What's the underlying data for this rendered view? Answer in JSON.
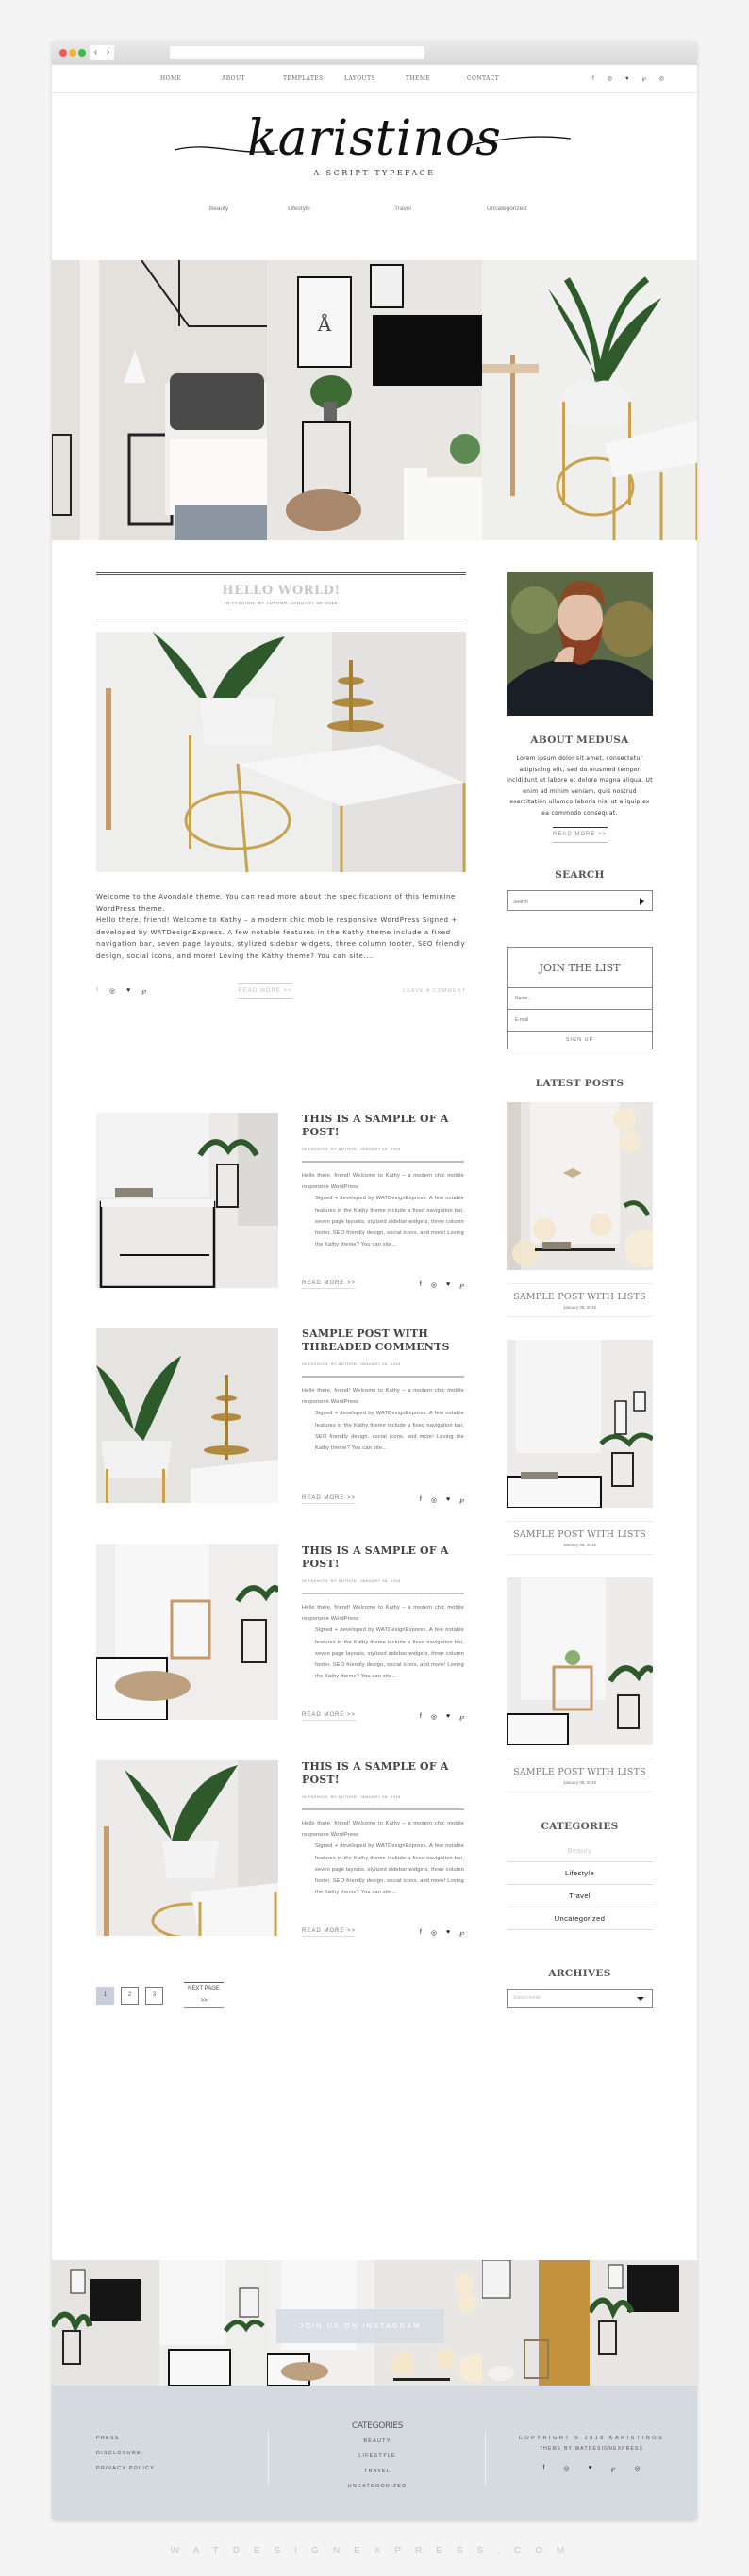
{
  "browser": {
    "back_icon": "‹",
    "forward_icon": "›"
  },
  "topnav": {
    "links": [
      "HOME",
      "ABOUT",
      "TEMPLATES",
      "LAYOUTS",
      "THEME",
      "CONTACT"
    ],
    "social_icons": [
      "facebook-icon",
      "instagram-icon",
      "twitter-icon",
      "pinterest-icon",
      "instagram-icon"
    ],
    "social_glyphs": [
      "f",
      "◎",
      "♥",
      "℘",
      "◎"
    ]
  },
  "header": {
    "logo_text": "karistinos",
    "tagline": "A SCRIPT TYPEFACE",
    "categories": [
      "Beauty",
      "Lifestyle",
      "Travel",
      "Uncategorized"
    ]
  },
  "featured_post": {
    "title": "HELLO WORLD!",
    "meta": "IN FASHION, BY AUTHOR, JANUARY 08, 2018",
    "paragraphs": [
      "Welcome to the Avondale theme. You can read more about the specifications of this feminine WordPress theme.",
      "Hello there, friend! Welcome to Kathy – a modern chic mobile responsive WordPress Signed + developed by WATDesignExpress. A few notable features in the Kathy theme include a fixed navigation bar, seven page layouts, stylized sidebar widgets, three column footer, SEO friendly design, social icons, and more! Loving the Kathy theme? You can site...."
    ],
    "read_more": "READ MORE >>",
    "leave_comment": "LEAVE A COMMENT",
    "share_glyphs": [
      "f",
      "◎",
      "♥",
      "℘"
    ]
  },
  "posts": [
    {
      "title": "THIS IS A SAMPLE OF A POST!",
      "meta": "IN FASHION, BY AUTHOR, JANUARY 08, 2018",
      "line1": "Hello there, friend! Welcome to Kathy – a modern chic mobile responsive WordPress",
      "line2": "Signed + developed by WATDesignExpress. A few notable features in the Kathy theme include a fixed navigation bar, seven page layouts, stylized sidebar widgets, three column footer, SEO friendly design, social icons, and more! Loving the Kathy theme? You can site...",
      "read_more": "READ MORE >>"
    },
    {
      "title": "SAMPLE POST WITH THREADED COMMENTS",
      "meta": "IN FASHION, BY AUTHOR, JANUARY 08, 2018",
      "line1": "Hello there, friend! Welcome to Kathy – a modern chic mobile responsive WordPress",
      "line2": "Signed + developed by WATDesignExpress. A few notable features in the Kathy theme include a fixed navigation bar, SEO friendly design, social icons, and more! Loving the Kathy theme? You can site...",
      "read_more": "READ MORE >>"
    },
    {
      "title": "THIS IS A SAMPLE OF A POST!",
      "meta": "IN FASHION, BY AUTHOR, JANUARY 08, 2018",
      "line1": "Hello there, friend! Welcome to Kathy – a modern chic mobile responsive WordPress",
      "line2": "Signed + developed by WATDesignExpress. A few notable features in the Kathy theme include a fixed navigation bar, seven page layouts, stylized sidebar widgets, three column footer, SEO friendly design, social icons, and more! Loving the Kathy theme? You can site...",
      "read_more": "READ MORE >>"
    },
    {
      "title": "THIS IS A SAMPLE OF A POST!",
      "meta": "IN FASHION, BY AUTHOR, JANUARY 08, 2018",
      "line1": "Hello there, friend! Welcome to Kathy – a modern chic mobile responsive WordPress",
      "line2": "Signed + developed by WATDesignExpress. A few notable features in the Kathy theme include a fixed navigation bar, seven page layouts, stylized sidebar widgets, three column footer, SEO friendly design, social icons, and more! Loving the Kathy theme? You can site...",
      "read_more": "READ MORE >>"
    }
  ],
  "pagination": {
    "pages": [
      "1",
      "2",
      "3"
    ],
    "current": "1",
    "next": "NEXT PAGE >>"
  },
  "sidebar": {
    "about": {
      "title": "ABOUT MEDUSA",
      "text": "Lorem ipsum dolor sit amet, consectetur adipiscing elit, sed do eiusmod tempor incididunt ut labore et dolore magna aliqua. Ut enim ad minim veniam, quis nostrud exercitation ullamco laboris nisi ut aliquip ex ea commodo consequat.",
      "read_more": "READ MORE >>"
    },
    "search": {
      "title": "SEARCH",
      "placeholder": "Search"
    },
    "newsletter": {
      "title": "JOIN THE LIST",
      "name_placeholder": "Name...",
      "email_placeholder": "E-mail",
      "button": "SIGN UP"
    },
    "latest": {
      "title": "LATEST POSTS",
      "items": [
        {
          "title": "SAMPLE POST WITH LISTS",
          "date": "January 08, 2018"
        },
        {
          "title": "SAMPLE POST WITH LISTS",
          "date": "January 08, 2018"
        },
        {
          "title": "SAMPLE POST WITH LISTS",
          "date": "January 08, 2018"
        }
      ]
    },
    "categories": {
      "title": "CATEGORIES",
      "items": [
        "Beauty",
        "Lifestyle",
        "Travel",
        "Uncategorized"
      ]
    },
    "archives": {
      "title": "ARCHIVES",
      "placeholder": "Select month"
    }
  },
  "instagram": {
    "label": "JOIN US ON INSTAGRAM"
  },
  "footer": {
    "links": [
      "PRESS",
      "DISCLOSURE",
      "PRIVACY POLICY"
    ],
    "categories_title": "CATEGORIES",
    "categories": [
      "BEAUTY",
      "LIFESTYLE",
      "TRAVEL",
      "UNCATEGORIZED"
    ],
    "copyright": "COPYRIGHT © 2018 KARISTINOS",
    "theme_by": "THEME BY WATDESIGNEXPRESS",
    "social_glyphs": [
      "f",
      "◎",
      "♥",
      "℘",
      "◎"
    ]
  },
  "watermark": "WATDESIGNEXPRESS.COM",
  "colors": {
    "footer_bg": "#d5d9e0",
    "pager_active": "#c9cfda",
    "page_bg": "#f4f4f4"
  }
}
